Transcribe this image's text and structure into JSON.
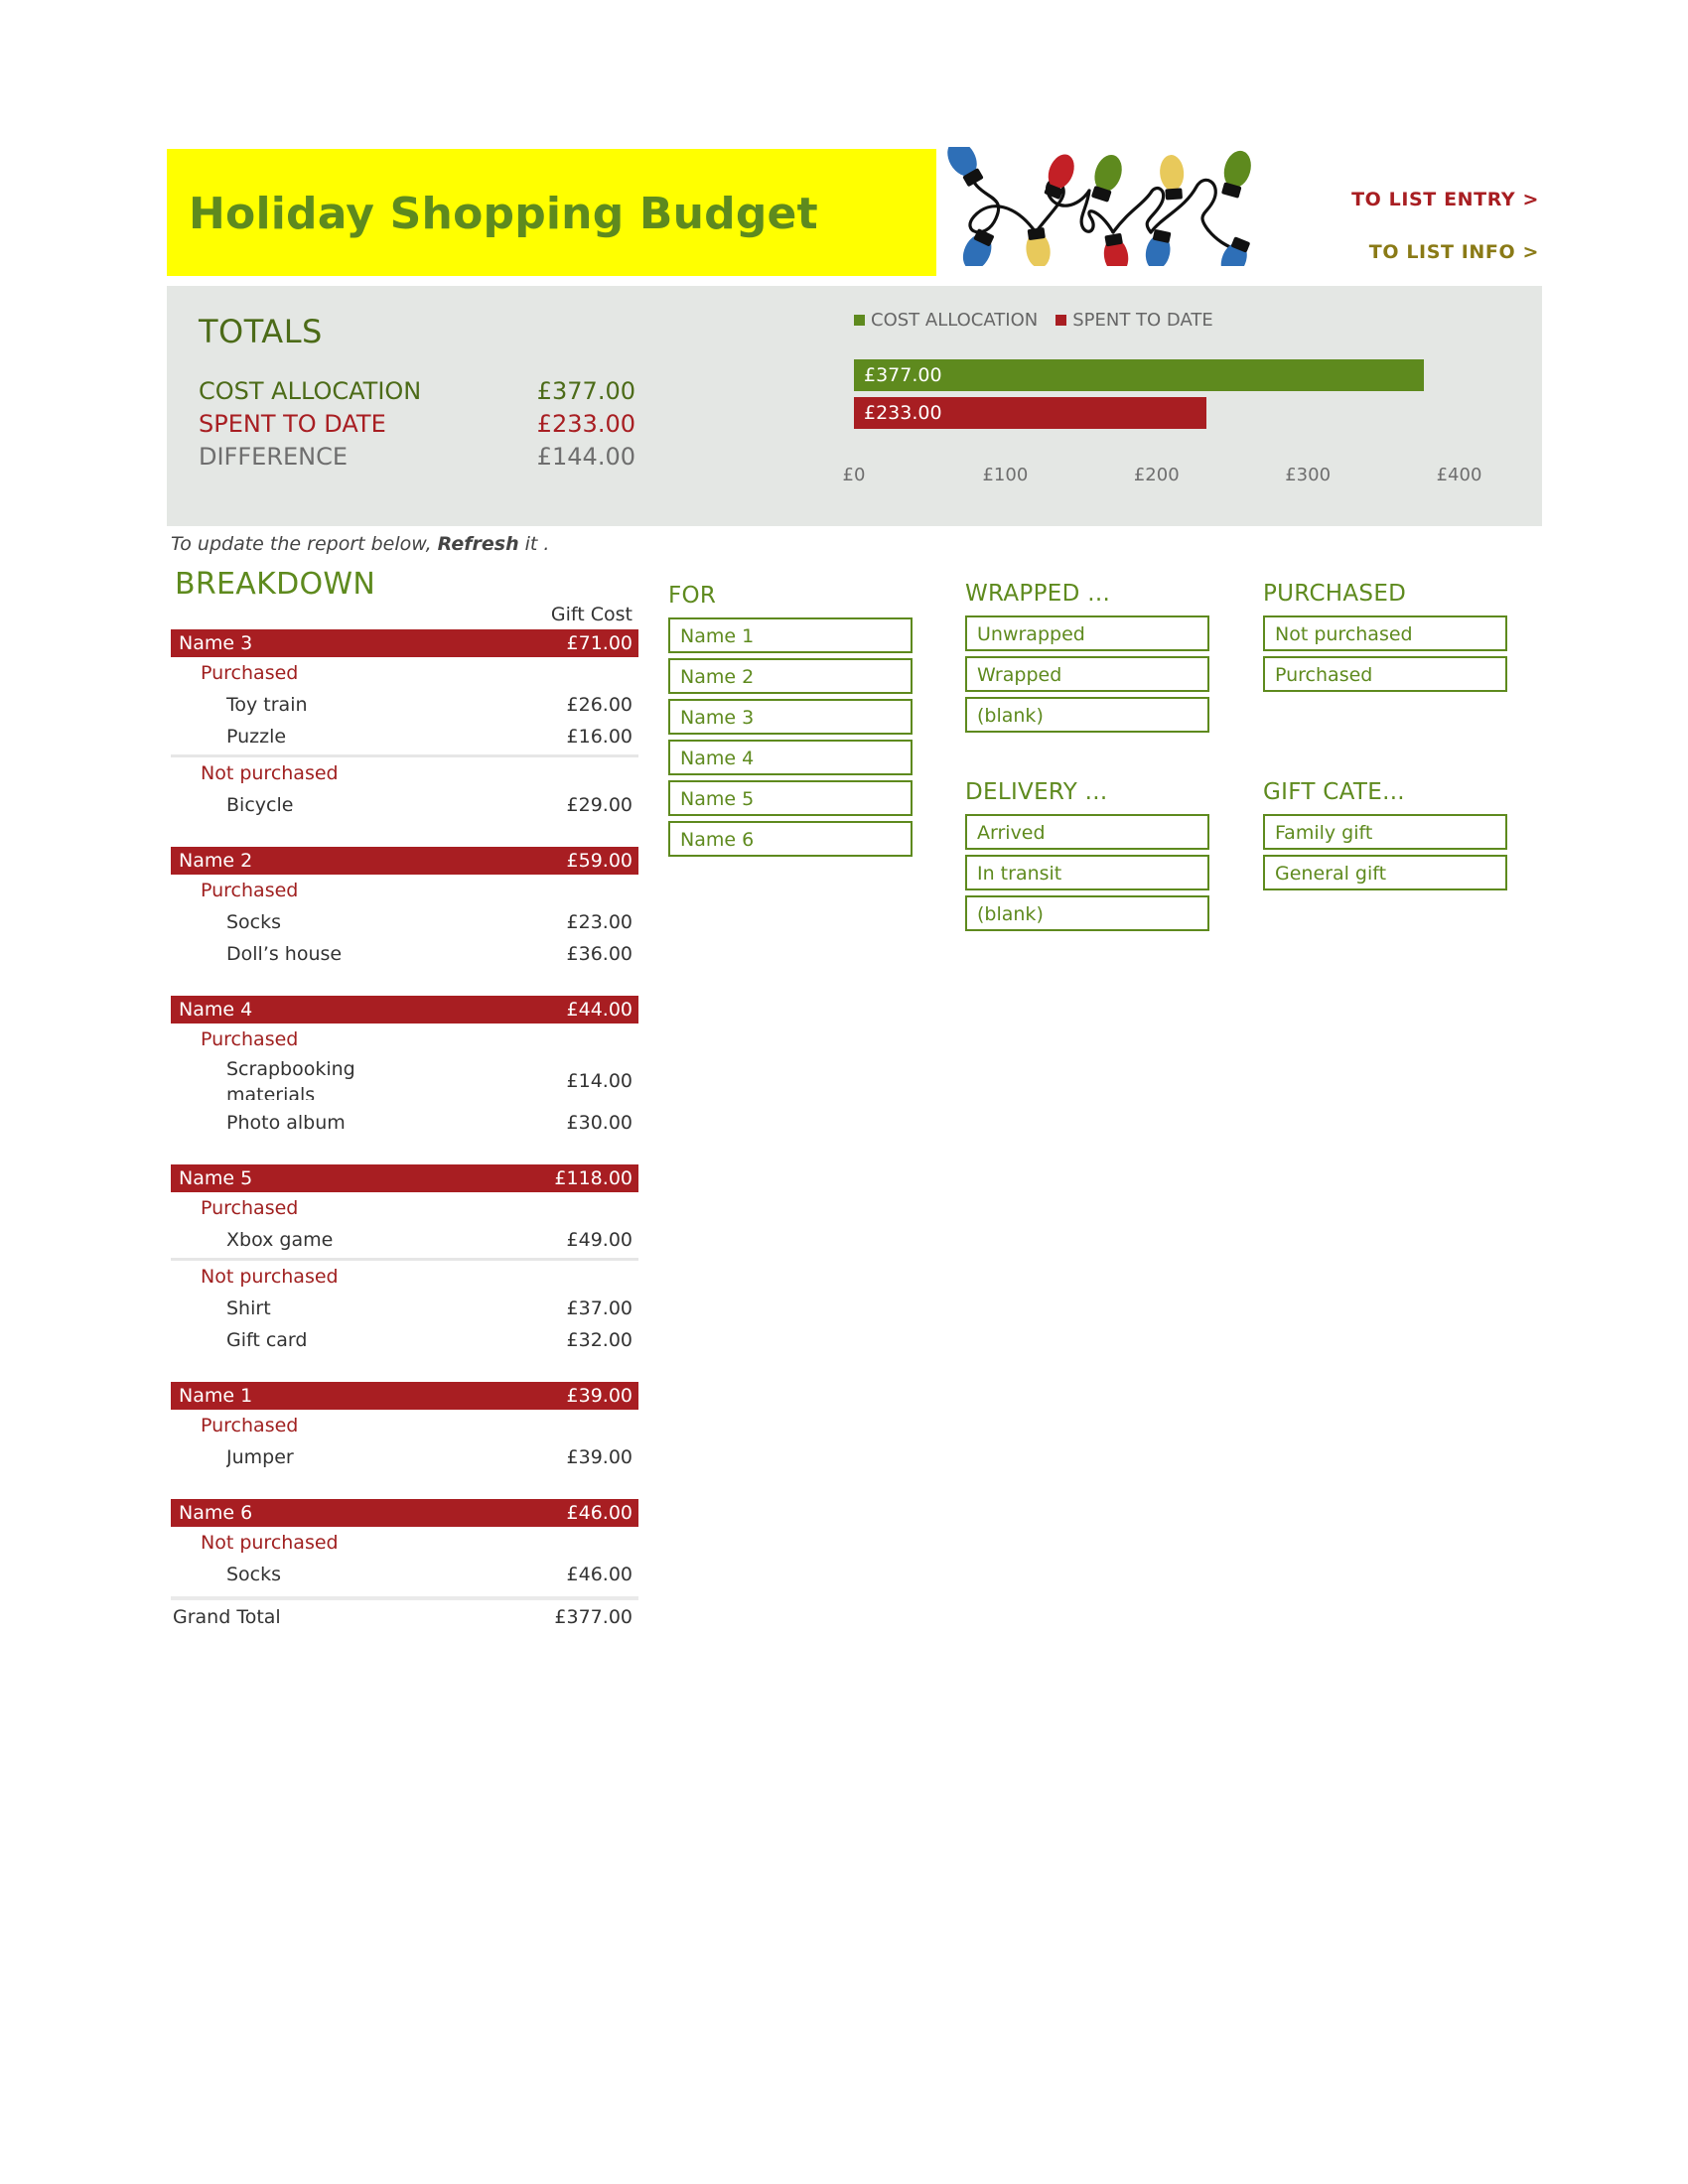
{
  "header": {
    "title": "Holiday Shopping Budget",
    "lights_icon": "string-lights-icon",
    "links": [
      {
        "id": "to-list-entry",
        "label": "TO LIST ENTRY >",
        "color": "#A81E22"
      },
      {
        "id": "to-list-info",
        "label": "TO LIST INFO >",
        "color": "#8A7A16"
      }
    ]
  },
  "totals": {
    "heading": "TOTALS",
    "rows": [
      {
        "label": "COST ALLOCATION",
        "value": "£377.00",
        "color": "#4C6B18"
      },
      {
        "label": "SPENT TO DATE",
        "value": "£233.00",
        "color": "#A81E22"
      },
      {
        "label": "DIFFERENCE",
        "value": "£144.00",
        "color": "#6E6E6E"
      }
    ]
  },
  "chart_data": {
    "type": "bar",
    "orientation": "horizontal",
    "title": "",
    "categories": [
      "COST ALLOCATION",
      "SPENT TO DATE"
    ],
    "values": [
      377,
      233
    ],
    "data_labels": [
      "£377.00",
      "£233.00"
    ],
    "series": [
      {
        "name": "COST ALLOCATION",
        "values": [
          377
        ],
        "color": "#5E8A1E"
      },
      {
        "name": "SPENT TO DATE",
        "values": [
          233
        ],
        "color": "#A81E22"
      }
    ],
    "legend": [
      "COST ALLOCATION",
      "SPENT TO DATE"
    ],
    "legend_position": "top-left",
    "xlabel": "",
    "ylabel": "",
    "xlim": [
      0,
      420
    ],
    "xticks": [
      0,
      100,
      200,
      300,
      400
    ],
    "xticklabels": [
      "£0",
      "£100",
      "£200",
      "£300",
      "£400"
    ],
    "grid": false
  },
  "refresh_note": {
    "prefix": "To update the report below, ",
    "bold": "Refresh",
    "suffix": " it ."
  },
  "breakdown": {
    "heading": "BREAKDOWN",
    "column_header": "Gift Cost",
    "people": [
      {
        "name": "Name 3",
        "total": "£71.00",
        "groups": [
          {
            "status": "Purchased",
            "gifts": [
              {
                "name": "Toy train",
                "amount": "£26.00"
              },
              {
                "name": "Puzzle",
                "amount": "£16.00"
              }
            ]
          },
          {
            "status": "Not purchased",
            "gifts": [
              {
                "name": "Bicycle",
                "amount": "£29.00"
              }
            ]
          }
        ]
      },
      {
        "name": "Name 2",
        "total": "£59.00",
        "groups": [
          {
            "status": "Purchased",
            "gifts": [
              {
                "name": "Socks",
                "amount": "£23.00"
              },
              {
                "name": "Doll’s house",
                "amount": "£36.00"
              }
            ]
          }
        ]
      },
      {
        "name": "Name 4",
        "total": "£44.00",
        "groups": [
          {
            "status": "Purchased",
            "gifts": [
              {
                "name": "Scrapbooking materials",
                "amount": "£14.00",
                "clipped": true
              },
              {
                "name": "Photo album",
                "amount": "£30.00"
              }
            ]
          }
        ]
      },
      {
        "name": "Name 5",
        "total": "£118.00",
        "groups": [
          {
            "status": "Purchased",
            "gifts": [
              {
                "name": "Xbox game",
                "amount": "£49.00"
              }
            ]
          },
          {
            "status": "Not purchased",
            "gifts": [
              {
                "name": "Shirt",
                "amount": "£37.00"
              },
              {
                "name": "Gift card",
                "amount": "£32.00"
              }
            ]
          }
        ]
      },
      {
        "name": "Name 1",
        "total": "£39.00",
        "groups": [
          {
            "status": "Purchased",
            "gifts": [
              {
                "name": "Jumper",
                "amount": "£39.00"
              }
            ]
          }
        ]
      },
      {
        "name": "Name 6",
        "total": "£46.00",
        "groups": [
          {
            "status": "Not purchased",
            "gifts": [
              {
                "name": "Socks",
                "amount": "£46.00"
              }
            ]
          }
        ]
      }
    ],
    "grand_total_label": "Grand Total",
    "grand_total_value": "£377.00"
  },
  "slicers": [
    {
      "id": "for",
      "title": "FOR",
      "items": [
        "Name 1",
        "Name 2",
        "Name 3",
        "Name 4",
        "Name 5",
        "Name 6"
      ]
    },
    {
      "id": "wrapped",
      "title": "WRAPPED ...",
      "items": [
        "Unwrapped",
        "Wrapped",
        "(blank)"
      ]
    },
    {
      "id": "delivery",
      "title": "DELIVERY ...",
      "items": [
        "Arrived",
        "In transit",
        "(blank)"
      ]
    },
    {
      "id": "purchased",
      "title": "PURCHASED",
      "items": [
        "Not purchased",
        "Purchased"
      ]
    },
    {
      "id": "giftcat",
      "title": "GIFT CATE...",
      "items": [
        "Family gift",
        "General gift"
      ]
    }
  ]
}
